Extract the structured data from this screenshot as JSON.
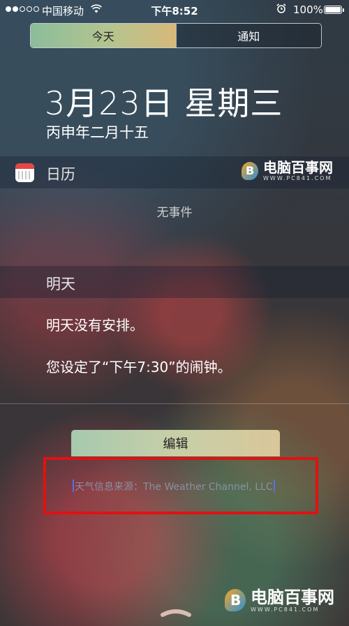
{
  "status_bar": {
    "carrier": "中国移动",
    "time": "下午8:52",
    "battery": "100%"
  },
  "segmented": {
    "today": "今天",
    "notifications": "通知"
  },
  "header": {
    "date": "3月23日 星期三",
    "lunar": "丙申年二月十五"
  },
  "calendar_widget": {
    "title": "日历",
    "empty": "无事件"
  },
  "tomorrow_widget": {
    "title": "明天",
    "line1": "明天没有安排。",
    "line2": "您设定了“下午7:30”的闹钟。"
  },
  "edit_button": "编辑",
  "weather_source": "天气信息来源：The Weather Channel, LLC",
  "watermark": {
    "name": "电脑百事网",
    "url": "WWW.PC841.COM"
  }
}
